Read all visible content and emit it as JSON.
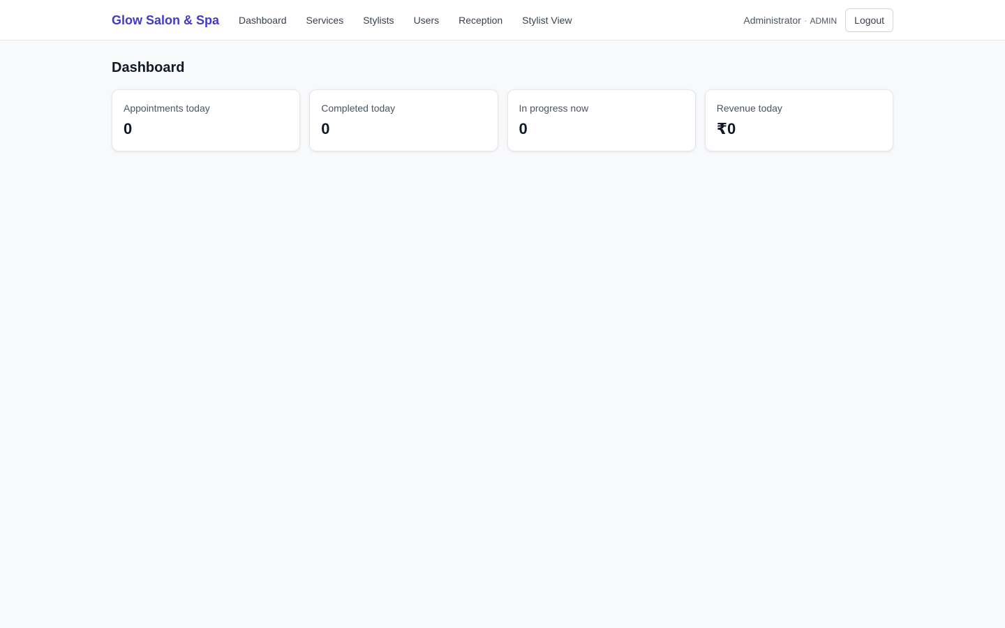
{
  "header": {
    "brand": "Glow Salon & Spa",
    "nav": [
      {
        "label": "Dashboard"
      },
      {
        "label": "Services"
      },
      {
        "label": "Stylists"
      },
      {
        "label": "Users"
      },
      {
        "label": "Reception"
      },
      {
        "label": "Stylist View"
      }
    ],
    "user": {
      "name": "Administrator",
      "separator": "·",
      "role": "ADMIN"
    },
    "logout_label": "Logout"
  },
  "main": {
    "title": "Dashboard",
    "stats": [
      {
        "label": "Appointments today",
        "value": "0"
      },
      {
        "label": "Completed today",
        "value": "0"
      },
      {
        "label": "In progress now",
        "value": "0"
      },
      {
        "label": "Revenue today",
        "value": "₹0"
      }
    ]
  },
  "colors": {
    "brand": "#4338ca",
    "background": "#f8f9fb",
    "card": "#ffffff"
  }
}
